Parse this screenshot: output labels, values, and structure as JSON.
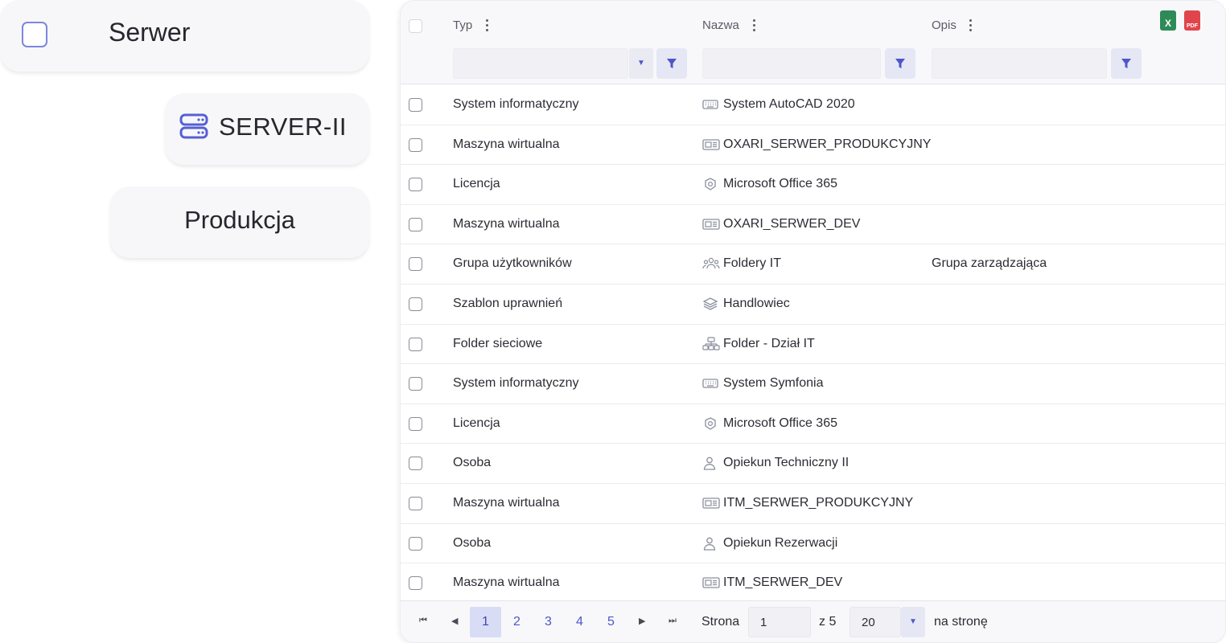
{
  "cards": {
    "serwer": "Serwer",
    "server_name": "SERVER-II",
    "produkcja": "Produkcja"
  },
  "grid": {
    "columns": [
      {
        "title": "Typ"
      },
      {
        "title": "Nazwa"
      },
      {
        "title": "Opis"
      }
    ],
    "export": {
      "excel": "X",
      "pdf": "PDF"
    },
    "rows": [
      {
        "typ": "System informatyczny",
        "icon": "keyboard-icon",
        "nazwa": "System AutoCAD 2020",
        "opis": ""
      },
      {
        "typ": "Maszyna wirtualna",
        "icon": "virtual-machine-icon",
        "nazwa": "OXARI_SERWER_PRODUKCYJNY",
        "opis": ""
      },
      {
        "typ": "Licencja",
        "icon": "license-icon",
        "nazwa": "Microsoft Office 365",
        "opis": ""
      },
      {
        "typ": "Maszyna wirtualna",
        "icon": "virtual-machine-icon",
        "nazwa": "OXARI_SERWER_DEV",
        "opis": ""
      },
      {
        "typ": "Grupa użytkowników",
        "icon": "user-group-icon",
        "nazwa": "Foldery IT",
        "opis": "Grupa zarządzająca"
      },
      {
        "typ": "Szablon uprawnień",
        "icon": "layers-icon",
        "nazwa": "Handlowiec",
        "opis": ""
      },
      {
        "typ": "Folder sieciowe",
        "icon": "network-folder-icon",
        "nazwa": "Folder - Dział IT",
        "opis": ""
      },
      {
        "typ": "System informatyczny",
        "icon": "keyboard-icon",
        "nazwa": "System Symfonia",
        "opis": ""
      },
      {
        "typ": "Licencja",
        "icon": "license-icon",
        "nazwa": "Microsoft Office 365",
        "opis": ""
      },
      {
        "typ": "Osoba",
        "icon": "person-icon",
        "nazwa": "Opiekun Techniczny II",
        "opis": ""
      },
      {
        "typ": "Maszyna wirtualna",
        "icon": "virtual-machine-icon",
        "nazwa": "ITM_SERWER_PRODUKCYJNY",
        "opis": ""
      },
      {
        "typ": "Osoba",
        "icon": "person-icon",
        "nazwa": "Opiekun Rezerwacji",
        "opis": ""
      },
      {
        "typ": "Maszyna wirtualna",
        "icon": "virtual-machine-icon",
        "nazwa": "ITM_SERWER_DEV",
        "opis": ""
      }
    ]
  },
  "pager": {
    "pages": [
      "1",
      "2",
      "3",
      "4",
      "5"
    ],
    "current_page": "1",
    "page_label": "Strona",
    "page_input": "1",
    "of_label": "z 5",
    "page_size": "20",
    "per_page_label": "na stronę"
  },
  "colors": {
    "accent": "#4d57c9",
    "checkbox_border": "#7b86e0",
    "active_page_bg": "#d9dcf5",
    "excel": "#2e8b57",
    "pdf": "#e0454c"
  }
}
